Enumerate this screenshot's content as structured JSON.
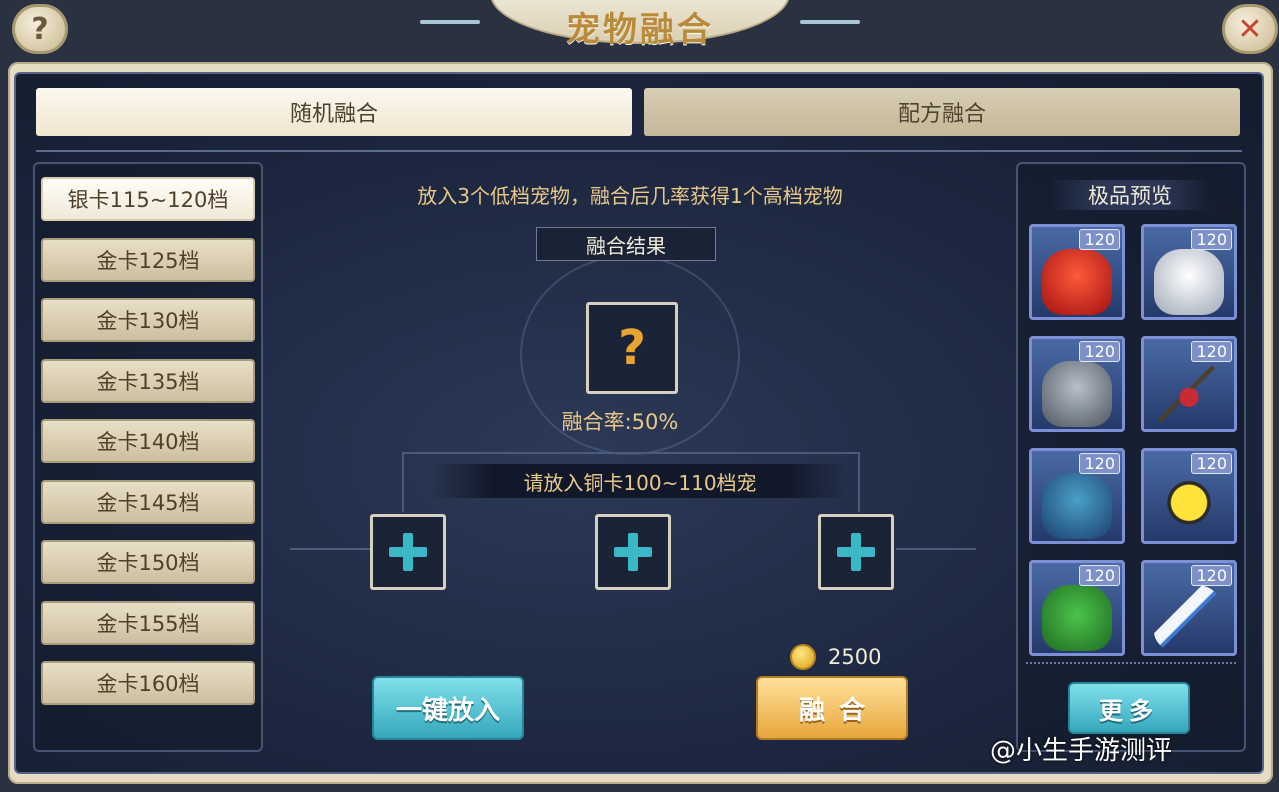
{
  "title": "宠物融合",
  "help_icon": "?",
  "close_icon": "✕",
  "tabs": [
    {
      "label": "随机融合",
      "active": true
    },
    {
      "label": "配方融合",
      "active": false
    }
  ],
  "grades": [
    {
      "label": "银卡115~120档",
      "active": true
    },
    {
      "label": "金卡125档",
      "active": false
    },
    {
      "label": "金卡130档",
      "active": false
    },
    {
      "label": "金卡135档",
      "active": false
    },
    {
      "label": "金卡140档",
      "active": false
    },
    {
      "label": "金卡145档",
      "active": false
    },
    {
      "label": "金卡150档",
      "active": false
    },
    {
      "label": "金卡155档",
      "active": false
    },
    {
      "label": "金卡160档",
      "active": false
    }
  ],
  "fusion": {
    "hint": "放入3个低档宠物，融合后几率获得1个高档宠物",
    "result_label": "融合结果",
    "result_placeholder": "?",
    "rate": "融合率:50%",
    "put_label": "请放入铜卡100~110档宠",
    "cost": "2500",
    "auto_button": "一键放入",
    "fuse_button": "融合"
  },
  "preview": {
    "title": "极品预览",
    "pets": [
      {
        "level": "120",
        "icon": "red-beast-icon"
      },
      {
        "level": "120",
        "icon": "white-beast-icon"
      },
      {
        "level": "120",
        "icon": "stone-golem-icon"
      },
      {
        "level": "120",
        "icon": "masked-insect-icon"
      },
      {
        "level": "120",
        "icon": "blue-demon-icon"
      },
      {
        "level": "120",
        "icon": "yellow-spider-icon"
      },
      {
        "level": "120",
        "icon": "cactus-icon"
      },
      {
        "level": "120",
        "icon": "blade-icon"
      }
    ],
    "more_button": "更多"
  },
  "watermark": "@小生手游测评",
  "colors": {
    "accent_gold": "#e9c98a",
    "button_cyan": "#35a7bb",
    "button_orange": "#e8a63c",
    "panel_bg": "#1d2740"
  }
}
